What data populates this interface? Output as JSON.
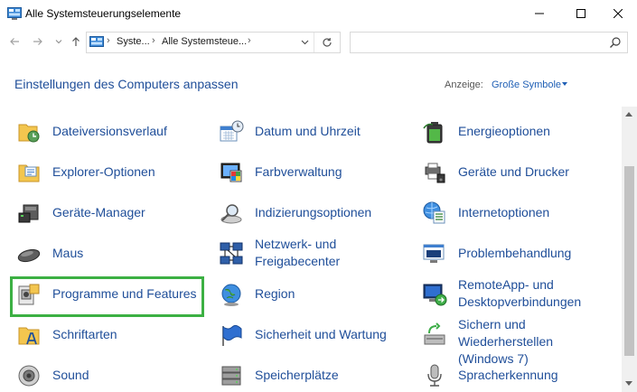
{
  "window": {
    "title": "Alle Systemsteuerungselemente"
  },
  "nav": {
    "breadcrumb": [
      "Syste...",
      "Alle Systemsteue..."
    ],
    "search_placeholder": ""
  },
  "header": {
    "title": "Einstellungen des Computers anpassen",
    "view_label": "Anzeige:",
    "view_value": "Große Symbole"
  },
  "items": [
    {
      "label": "Dateiversionsverlauf",
      "icon": "file-history-icon"
    },
    {
      "label": "Datum und Uhrzeit",
      "icon": "calendar-clock-icon"
    },
    {
      "label": "Energieoptionen",
      "icon": "battery-icon"
    },
    {
      "label": "Explorer-Optionen",
      "icon": "folder-options-icon"
    },
    {
      "label": "Farbverwaltung",
      "icon": "color-management-icon"
    },
    {
      "label": "Geräte und Drucker",
      "icon": "printer-icon"
    },
    {
      "label": "Geräte-Manager",
      "icon": "device-manager-icon"
    },
    {
      "label": "Indizierungsoptionen",
      "icon": "indexing-icon"
    },
    {
      "label": "Internetoptionen",
      "icon": "internet-options-icon"
    },
    {
      "label": "Maus",
      "icon": "mouse-icon"
    },
    {
      "label": "Netzwerk- und\nFreigabecenter",
      "icon": "network-icon"
    },
    {
      "label": "Problembehandlung",
      "icon": "troubleshooting-icon"
    },
    {
      "label": "Programme und Features",
      "icon": "programs-icon"
    },
    {
      "label": "Region",
      "icon": "globe-icon"
    },
    {
      "label": "RemoteApp- und\nDesktopverbindungen",
      "icon": "remote-desktop-icon"
    },
    {
      "label": "Schriftarten",
      "icon": "fonts-icon"
    },
    {
      "label": "Sicherheit und Wartung",
      "icon": "flag-icon"
    },
    {
      "label": "Sichern und\nWiederherstellen\n(Windows 7)",
      "icon": "backup-icon"
    },
    {
      "label": "Sound",
      "icon": "speaker-icon"
    },
    {
      "label": "Speicherplätze",
      "icon": "storage-spaces-icon"
    },
    {
      "label": "Spracherkennung",
      "icon": "microphone-icon"
    }
  ],
  "colors": {
    "link": "#1f4e99",
    "highlight": "#3cb043",
    "accent": "#1f5fb5"
  }
}
